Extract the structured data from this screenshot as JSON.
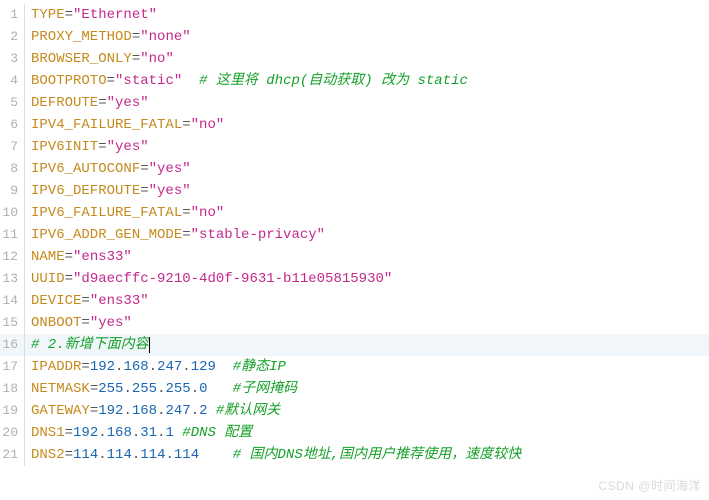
{
  "watermark": "CSDN @时间海洋",
  "lines": [
    {
      "n": "1",
      "parts": [
        {
          "c": "key",
          "t": "TYPE"
        },
        {
          "c": "eq",
          "t": "="
        },
        {
          "c": "str",
          "t": "\"Ethernet\""
        }
      ]
    },
    {
      "n": "2",
      "parts": [
        {
          "c": "key",
          "t": "PROXY_METHOD"
        },
        {
          "c": "eq",
          "t": "="
        },
        {
          "c": "str",
          "t": "\"none\""
        }
      ]
    },
    {
      "n": "3",
      "parts": [
        {
          "c": "key",
          "t": "BROWSER_ONLY"
        },
        {
          "c": "eq",
          "t": "="
        },
        {
          "c": "str",
          "t": "\"no\""
        }
      ]
    },
    {
      "n": "4",
      "parts": [
        {
          "c": "key",
          "t": "BOOTPROTO"
        },
        {
          "c": "eq",
          "t": "="
        },
        {
          "c": "str",
          "t": "\"static\""
        },
        {
          "c": "",
          "t": "  "
        },
        {
          "c": "cmt",
          "t": "# 这里将 dhcp(自动获取) 改为 static"
        }
      ]
    },
    {
      "n": "5",
      "parts": [
        {
          "c": "key",
          "t": "DEFROUTE"
        },
        {
          "c": "eq",
          "t": "="
        },
        {
          "c": "str",
          "t": "\"yes\""
        }
      ]
    },
    {
      "n": "6",
      "parts": [
        {
          "c": "key",
          "t": "IPV4_FAILURE_FATAL"
        },
        {
          "c": "eq",
          "t": "="
        },
        {
          "c": "str",
          "t": "\"no\""
        }
      ]
    },
    {
      "n": "7",
      "parts": [
        {
          "c": "key",
          "t": "IPV6INIT"
        },
        {
          "c": "eq",
          "t": "="
        },
        {
          "c": "str",
          "t": "\"yes\""
        }
      ]
    },
    {
      "n": "8",
      "parts": [
        {
          "c": "key",
          "t": "IPV6_AUTOCONF"
        },
        {
          "c": "eq",
          "t": "="
        },
        {
          "c": "str",
          "t": "\"yes\""
        }
      ]
    },
    {
      "n": "9",
      "parts": [
        {
          "c": "key",
          "t": "IPV6_DEFROUTE"
        },
        {
          "c": "eq",
          "t": "="
        },
        {
          "c": "str",
          "t": "\"yes\""
        }
      ]
    },
    {
      "n": "10",
      "parts": [
        {
          "c": "key",
          "t": "IPV6_FAILURE_FATAL"
        },
        {
          "c": "eq",
          "t": "="
        },
        {
          "c": "str",
          "t": "\"no\""
        }
      ]
    },
    {
      "n": "11",
      "parts": [
        {
          "c": "key",
          "t": "IPV6_ADDR_GEN_MODE"
        },
        {
          "c": "eq",
          "t": "="
        },
        {
          "c": "str",
          "t": "\"stable-privacy\""
        }
      ]
    },
    {
      "n": "12",
      "parts": [
        {
          "c": "key",
          "t": "NAME"
        },
        {
          "c": "eq",
          "t": "="
        },
        {
          "c": "str",
          "t": "\"ens33\""
        }
      ]
    },
    {
      "n": "13",
      "parts": [
        {
          "c": "key",
          "t": "UUID"
        },
        {
          "c": "eq",
          "t": "="
        },
        {
          "c": "str",
          "t": "\"d9aecffc-9210-4d0f-9631-b11e05815930\""
        }
      ]
    },
    {
      "n": "14",
      "parts": [
        {
          "c": "key",
          "t": "DEVICE"
        },
        {
          "c": "eq",
          "t": "="
        },
        {
          "c": "str",
          "t": "\"ens33\""
        }
      ]
    },
    {
      "n": "15",
      "parts": [
        {
          "c": "key",
          "t": "ONBOOT"
        },
        {
          "c": "eq",
          "t": "="
        },
        {
          "c": "str",
          "t": "\"yes\""
        }
      ]
    },
    {
      "n": "16",
      "hl": true,
      "cursor": true,
      "parts": [
        {
          "c": "cmt",
          "t": "# 2.新增下面内容"
        }
      ]
    },
    {
      "n": "17",
      "parts": [
        {
          "c": "key",
          "t": "IPADDR"
        },
        {
          "c": "eq",
          "t": "="
        },
        {
          "c": "num",
          "t": "192"
        },
        {
          "c": "dot",
          "t": "."
        },
        {
          "c": "num",
          "t": "168"
        },
        {
          "c": "dot",
          "t": "."
        },
        {
          "c": "num",
          "t": "247"
        },
        {
          "c": "dot",
          "t": "."
        },
        {
          "c": "num",
          "t": "129"
        },
        {
          "c": "",
          "t": "  "
        },
        {
          "c": "cmt",
          "t": "#静态IP"
        }
      ]
    },
    {
      "n": "18",
      "parts": [
        {
          "c": "key",
          "t": "NETMASK"
        },
        {
          "c": "eq",
          "t": "="
        },
        {
          "c": "num",
          "t": "255"
        },
        {
          "c": "dot",
          "t": "."
        },
        {
          "c": "num",
          "t": "255"
        },
        {
          "c": "dot",
          "t": "."
        },
        {
          "c": "num",
          "t": "255"
        },
        {
          "c": "dot",
          "t": "."
        },
        {
          "c": "num",
          "t": "0"
        },
        {
          "c": "",
          "t": "   "
        },
        {
          "c": "cmt",
          "t": "#子网掩码"
        }
      ]
    },
    {
      "n": "19",
      "parts": [
        {
          "c": "key",
          "t": "GATEWAY"
        },
        {
          "c": "eq",
          "t": "="
        },
        {
          "c": "num",
          "t": "192"
        },
        {
          "c": "dot",
          "t": "."
        },
        {
          "c": "num",
          "t": "168"
        },
        {
          "c": "dot",
          "t": "."
        },
        {
          "c": "num",
          "t": "247"
        },
        {
          "c": "dot",
          "t": "."
        },
        {
          "c": "num",
          "t": "2"
        },
        {
          "c": "",
          "t": " "
        },
        {
          "c": "cmt",
          "t": "#默认网关"
        }
      ]
    },
    {
      "n": "20",
      "parts": [
        {
          "c": "key",
          "t": "DNS1"
        },
        {
          "c": "eq",
          "t": "="
        },
        {
          "c": "num",
          "t": "192"
        },
        {
          "c": "dot",
          "t": "."
        },
        {
          "c": "num",
          "t": "168"
        },
        {
          "c": "dot",
          "t": "."
        },
        {
          "c": "num",
          "t": "31"
        },
        {
          "c": "dot",
          "t": "."
        },
        {
          "c": "num",
          "t": "1"
        },
        {
          "c": "",
          "t": " "
        },
        {
          "c": "cmt",
          "t": "#DNS 配置"
        }
      ]
    },
    {
      "n": "21",
      "parts": [
        {
          "c": "key",
          "t": "DNS2"
        },
        {
          "c": "eq",
          "t": "="
        },
        {
          "c": "num",
          "t": "114"
        },
        {
          "c": "dot",
          "t": "."
        },
        {
          "c": "num",
          "t": "114"
        },
        {
          "c": "dot",
          "t": "."
        },
        {
          "c": "num",
          "t": "114"
        },
        {
          "c": "dot",
          "t": "."
        },
        {
          "c": "num",
          "t": "114"
        },
        {
          "c": "",
          "t": "    "
        },
        {
          "c": "cmt",
          "t": "# 国内DNS地址,国内用户推荐使用，速度较快"
        }
      ]
    }
  ]
}
